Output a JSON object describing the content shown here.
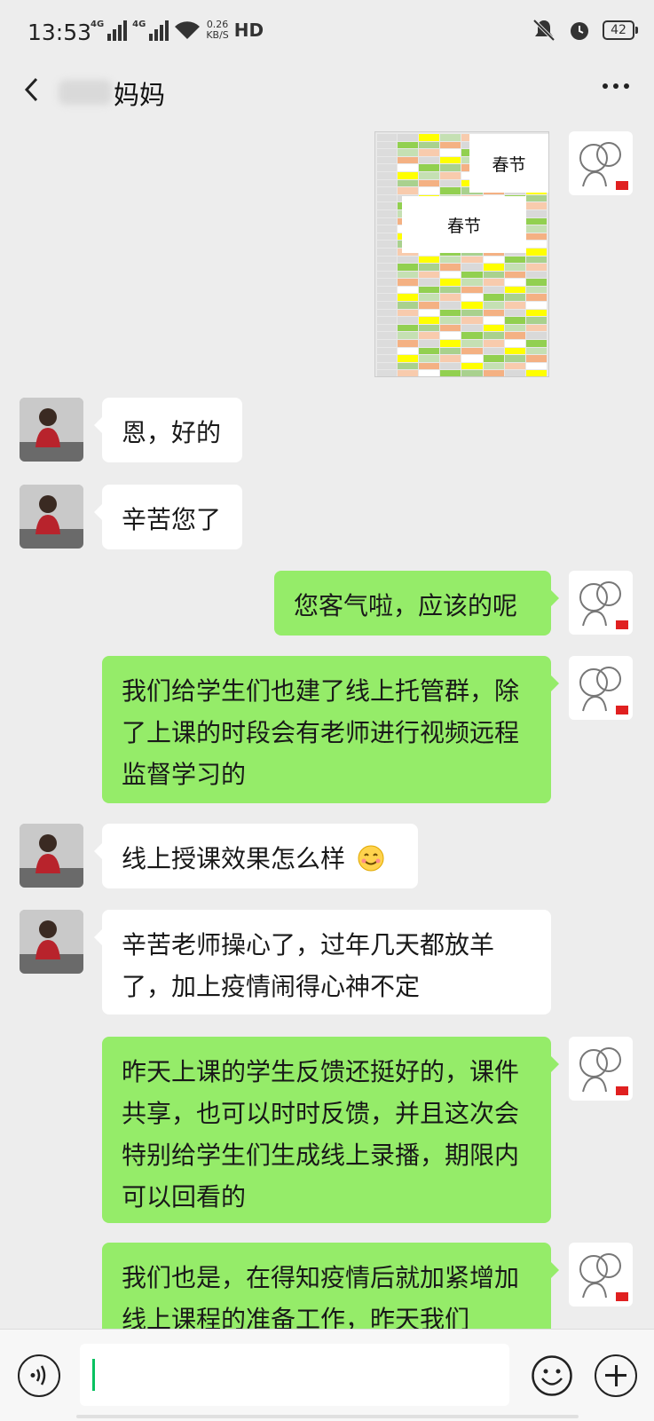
{
  "status_bar": {
    "time": "13:53",
    "network_1": "4G",
    "network_2": "4G",
    "speed_value": "0.26",
    "speed_unit": "KB/S",
    "hd": "HD",
    "battery": "42"
  },
  "header": {
    "title": "妈妈",
    "back_icon": "chevron-left-icon",
    "more_icon": "more-dots-icon"
  },
  "schedule_image": {
    "label_top": "春节",
    "label_mid": "春节"
  },
  "messages": [
    {
      "sender": "me",
      "type": "image"
    },
    {
      "sender": "other",
      "text": "恩，好的"
    },
    {
      "sender": "other",
      "text": "辛苦您了"
    },
    {
      "sender": "me",
      "text": "您客气啦，应该的呢"
    },
    {
      "sender": "me",
      "text": "我们给学生们也建了线上托管群，除了上课的时段会有老师进行视频远程监督学习的"
    },
    {
      "sender": "other",
      "text": "线上授课效果怎么样"
    },
    {
      "sender": "other",
      "text": "辛苦老师操心了，过年几天都放羊了，加上疫情闹得心神不定"
    },
    {
      "sender": "me",
      "text": "昨天上课的学生反馈还挺好的，课件共享，也可以时时反馈，并且这次会特别给学生们生成线上录播，期限内可以回看的"
    },
    {
      "sender": "me",
      "text": "我们也是，在得知疫情后就加紧增加线上课程的准备工作，昨天我们"
    }
  ],
  "input_bar": {
    "voice_icon": "voice-icon",
    "emoji_icon": "emoji-icon",
    "plus_icon": "plus-icon"
  },
  "colors": {
    "background": "#ededed",
    "bubble_me": "#95ec69",
    "bubble_other": "#ffffff",
    "cursor": "#07c160"
  }
}
